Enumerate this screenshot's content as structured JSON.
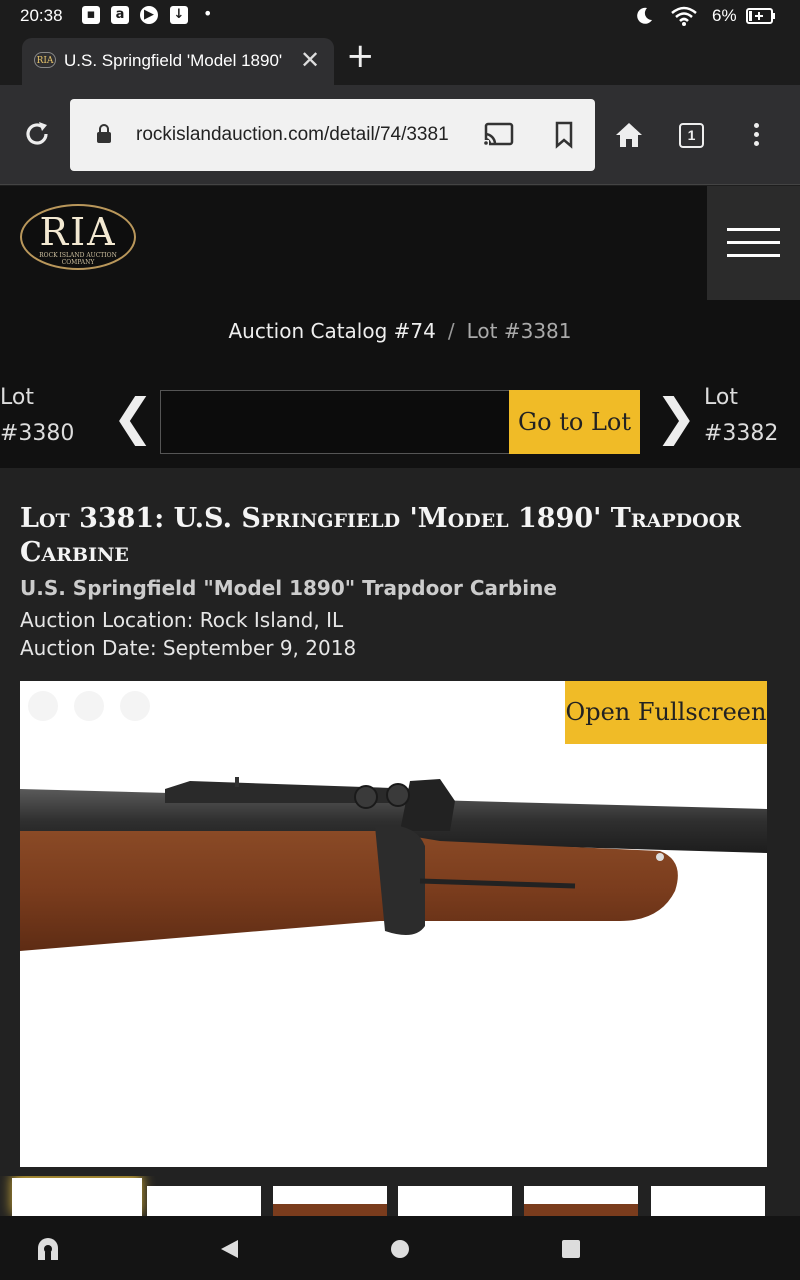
{
  "status_bar": {
    "time": "20:38",
    "battery": "6%",
    "icons": [
      "image-icon",
      "amazon-icon",
      "play-icon",
      "download-icon",
      "moon-icon",
      "wifi-icon",
      "battery-icon"
    ]
  },
  "browser": {
    "tab_title": "U.S. Springfield 'Model 1890'",
    "favicon_text": "RIA",
    "url": "rockislandauction.com/detail/74/3381",
    "tab_count": "1"
  },
  "site": {
    "logo_text": "RIA",
    "logo_subtext_1": "ROCK ISLAND AUCTION",
    "logo_subtext_2": "COMPANY"
  },
  "breadcrumb": {
    "catalog": "Auction Catalog #74",
    "separator": "/",
    "lot": "Lot #3381"
  },
  "lot_nav": {
    "prev_label": "Lot",
    "prev_number": "#3380",
    "next_label": "Lot",
    "next_number": "#3382",
    "input_value": "",
    "go_button": "Go to Lot"
  },
  "lot": {
    "title": "Lot 3381: U.S. Springfield 'Model 1890' Trapdoor Carbine",
    "subtitle": "U.S. Springfield \"Model 1890\" Trapdoor Carbine",
    "location": "Auction Location: Rock Island, IL",
    "date": "Auction Date: September 9, 2018",
    "fullscreen_button": "Open Fullscreen"
  },
  "colors": {
    "accent": "#f0bb27",
    "page_bg": "#222222",
    "header_bg": "#111111"
  }
}
